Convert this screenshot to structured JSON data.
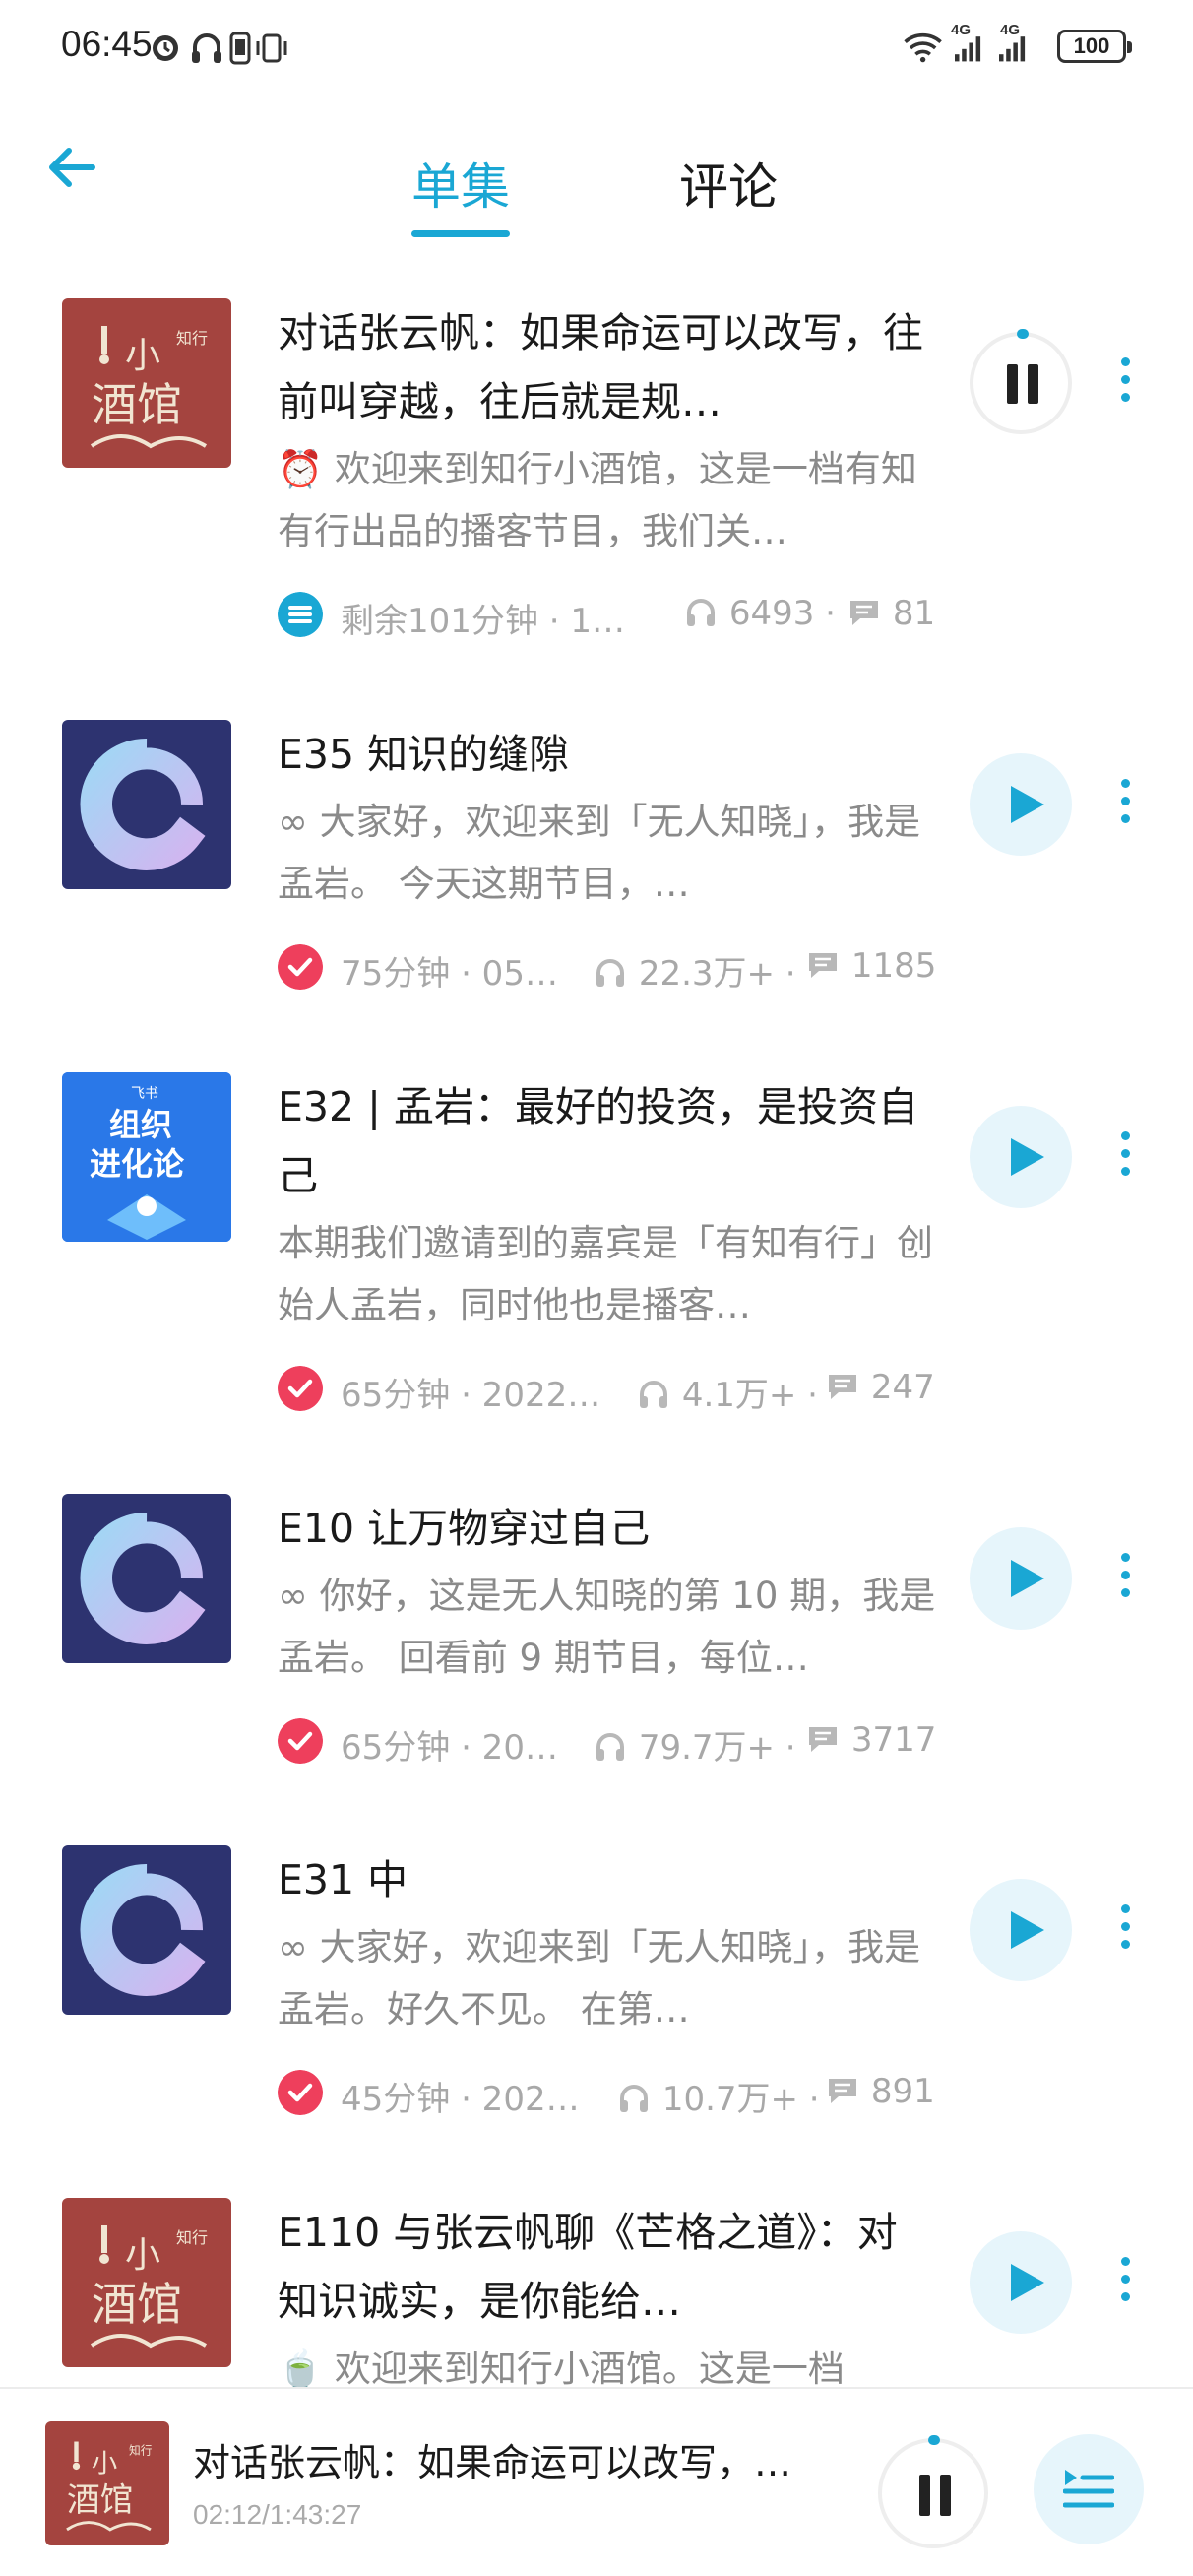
{
  "status_bar": {
    "time": "06:45",
    "network_label_1": "4G",
    "network_label_2": "4G",
    "battery": "100"
  },
  "header": {
    "tabs": [
      {
        "label": "单集",
        "active": true
      },
      {
        "label": "评论",
        "active": false
      }
    ]
  },
  "colors": {
    "accent": "#1aa7d4",
    "badge_red": "#ee3f5c",
    "cover_red": "#a4443f",
    "cover_navy": "#2d3370",
    "cover_blue": "#2a78e8"
  },
  "episodes": [
    {
      "cover": "xiaojiuguan",
      "title": "对话张云帆：如果命运可以改写，往前叫穿越，往后就是规…",
      "desc_icon": "⏰",
      "desc": "欢迎来到知行小酒馆，这是一档有知有行出品的播客节目，我们关…",
      "badge": "list",
      "duration": "剩余101分钟 · 1…",
      "plays": "6493 ·",
      "comments": "81",
      "state": "playing"
    },
    {
      "cover": "wurenzhixiao",
      "title": "E35 知识的缝隙",
      "desc_icon": "∞",
      "desc": "大家好，欢迎来到「无人知晓」，我是孟岩。 今天这期节目，…",
      "badge": "check",
      "duration": "75分钟 · 05…",
      "plays": "22.3万+ ·",
      "comments": "1185",
      "state": "paused"
    },
    {
      "cover": "zuzhijinhualun",
      "cover_text_top": "飞书",
      "cover_text_line1": "组织",
      "cover_text_line2": "进化论",
      "title": "E32 | 孟岩：最好的投资，是投资自己",
      "desc_icon": "",
      "desc": "本期我们邀请到的嘉宾是「有知有行」创始人孟岩，同时他也是播客…",
      "badge": "check",
      "duration": "65分钟 · 2022…",
      "plays": "4.1万+ ·",
      "comments": "247",
      "state": "paused"
    },
    {
      "cover": "wurenzhixiao",
      "title": "E10 让万物穿过自己",
      "desc_icon": "∞",
      "desc": "你好，这是无人知晓的第 10 期，我是孟岩。 回看前 9 期节目，每位…",
      "badge": "check",
      "duration": "65分钟 · 20…",
      "plays": "79.7万+ ·",
      "comments": "3717",
      "state": "paused"
    },
    {
      "cover": "wurenzhixiao",
      "title": "E31 中",
      "desc_icon": "∞",
      "desc": "大家好，欢迎来到「无人知晓」，我是孟岩。好久不见。 在第…",
      "badge": "check",
      "duration": "45分钟 · 202…",
      "plays": "10.7万+ ·",
      "comments": "891",
      "state": "paused"
    },
    {
      "cover": "xiaojiuguan",
      "title": "E110 与张云帆聊《芒格之道》：对知识诚实，是你能给…",
      "desc_icon": "🍵",
      "desc": "欢迎来到知行小酒馆。这是一档",
      "badge": "",
      "duration": "",
      "plays": "",
      "comments": "",
      "state": "paused"
    }
  ],
  "cover_xiaojiuguan": {
    "small": "小",
    "side": "知行",
    "big": "酒馆"
  },
  "mini_player": {
    "title": "对话张云帆：如果命运可以改写，…",
    "time": "02:12/1:43:27"
  }
}
